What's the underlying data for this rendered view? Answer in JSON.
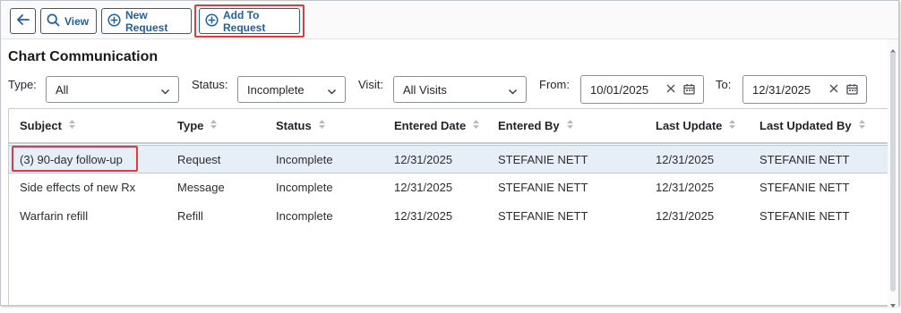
{
  "toolbar": {
    "view_label": "View",
    "new_request_label": "New Request",
    "add_to_request_label": "Add To Request"
  },
  "page": {
    "title": "Chart Communication"
  },
  "filters": {
    "type_label": "Type:",
    "type_value": "All",
    "status_label": "Status:",
    "status_value": "Incomplete",
    "visit_label": "Visit:",
    "visit_value": "All Visits",
    "from_label": "From:",
    "from_value": "10/01/2025",
    "to_label": "To:",
    "to_value": "12/31/2025"
  },
  "table": {
    "columns": [
      "Subject",
      "Type",
      "Status",
      "Entered Date",
      "Entered By",
      "Last Update",
      "Last Updated By"
    ],
    "rows": [
      [
        "(3) 90-day follow-up",
        "Request",
        "Incomplete",
        "12/31/2025",
        "STEFANIE NETT",
        "12/31/2025",
        "STEFANIE NETT"
      ],
      [
        "Side effects of new Rx",
        "Message",
        "Incomplete",
        "12/31/2025",
        "STEFANIE NETT",
        "12/31/2025",
        "STEFANIE NETT"
      ],
      [
        "Warfarin refill",
        "Refill",
        "Incomplete",
        "12/31/2025",
        "STEFANIE NETT",
        "12/31/2025",
        "STEFANIE NETT"
      ]
    ],
    "selected_row": 0
  },
  "icons": {
    "back": "arrow-left-icon",
    "view": "search-icon",
    "add": "plus-circle-icon",
    "dropdown": "chevron-down-icon",
    "clear": "close-icon",
    "calendar": "calendar-icon",
    "sort": "sort-icon"
  },
  "colors": {
    "accent": "#1f5fa6",
    "highlight": "#e0393e",
    "selected_row": "#e6eef7"
  }
}
